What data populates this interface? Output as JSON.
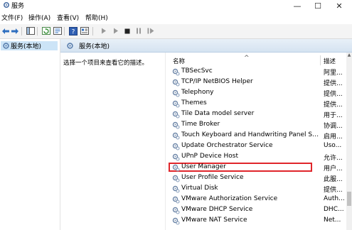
{
  "window": {
    "title": "服务",
    "minimize_glyph": "—",
    "maximize_glyph": "☐",
    "close_glyph": "✕"
  },
  "menu": {
    "file": "文件(F)",
    "action": "操作(A)",
    "view": "查看(V)",
    "help": "帮助(H)"
  },
  "tree": {
    "item_label": "服务(本地)"
  },
  "pane": {
    "header_label": "服务(本地)",
    "description_prompt": "选择一个项目来查看它的描述。"
  },
  "list": {
    "col_name": "名称",
    "col_desc": "描述",
    "sort_glyph": "^",
    "rows": [
      {
        "name": "TBSecSvc",
        "desc": "阿里..."
      },
      {
        "name": "TCP/IP NetBIOS Helper",
        "desc": "提供..."
      },
      {
        "name": "Telephony",
        "desc": "提供..."
      },
      {
        "name": "Themes",
        "desc": "提供..."
      },
      {
        "name": "Tile Data model server",
        "desc": "用于..."
      },
      {
        "name": "Time Broker",
        "desc": "协调..."
      },
      {
        "name": "Touch Keyboard and Handwriting Panel Servi...",
        "desc": "启用..."
      },
      {
        "name": "Update Orchestrator Service",
        "desc": "Uso..."
      },
      {
        "name": "UPnP Device Host",
        "desc": "允许..."
      },
      {
        "name": "User Manager",
        "desc": "用户..."
      },
      {
        "name": "User Profile Service",
        "desc": "此服..."
      },
      {
        "name": "Virtual Disk",
        "desc": "提供..."
      },
      {
        "name": "VMware Authorization Service",
        "desc": "Auth..."
      },
      {
        "name": "VMware DHCP Service",
        "desc": "DHC..."
      },
      {
        "name": "VMware NAT Service",
        "desc": "Net..."
      }
    ],
    "highlighted_row": "User Manager",
    "highlight_color": "#e0262b"
  },
  "colors": {
    "selection": "#cce4f7",
    "header_gradient_top": "#e8f0f8",
    "header_gradient_bottom": "#d5e3f1"
  }
}
